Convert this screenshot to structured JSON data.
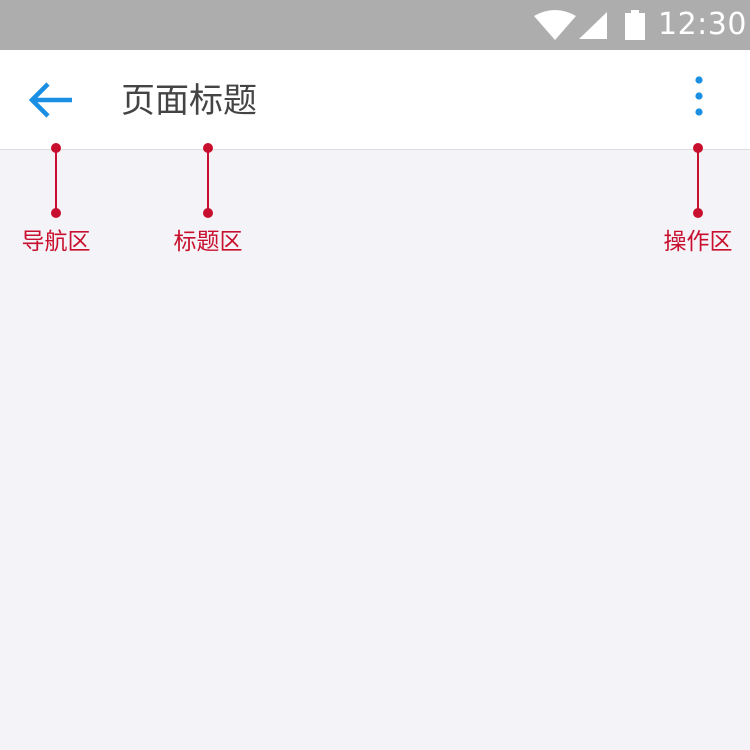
{
  "status_bar": {
    "time": "12:30",
    "icons": [
      "wifi-icon",
      "signal-icon",
      "battery-icon"
    ],
    "color": "#adadad"
  },
  "app_bar": {
    "back_icon": "arrow-left-icon",
    "title": "页面标题",
    "more_icon": "more-vertical-icon",
    "accent_color": "#1a8fe3"
  },
  "annotations": [
    {
      "label": "导航区"
    },
    {
      "label": "标题区"
    },
    {
      "label": "操作区"
    }
  ],
  "annotation_color": "#c8102e"
}
